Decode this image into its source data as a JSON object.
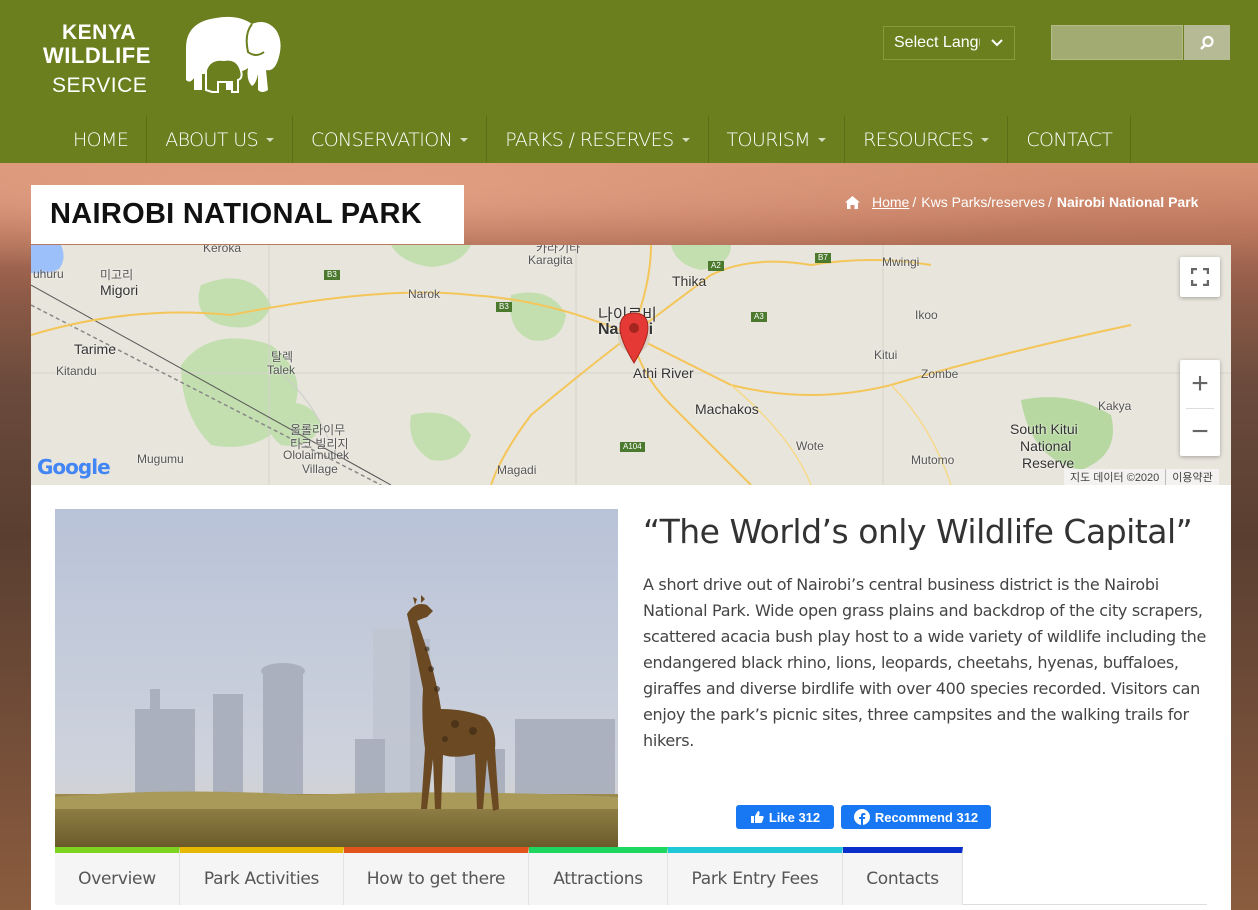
{
  "header": {
    "logo": {
      "line1": "KENYA",
      "line2": "WILDLIFE",
      "line3": "SERVICE"
    },
    "language_select": {
      "value": "Select Language"
    },
    "search": {
      "placeholder": ""
    }
  },
  "nav": {
    "items": [
      {
        "label": "HOME",
        "has_dropdown": false
      },
      {
        "label": "ABOUT US",
        "has_dropdown": true
      },
      {
        "label": "CONSERVATION",
        "has_dropdown": true
      },
      {
        "label": "PARKS / RESERVES",
        "has_dropdown": true
      },
      {
        "label": "TOURISM",
        "has_dropdown": true
      },
      {
        "label": "RESOURCES",
        "has_dropdown": true
      },
      {
        "label": "CONTACT",
        "has_dropdown": false
      }
    ]
  },
  "page": {
    "title": "NAIROBI NATIONAL PARK"
  },
  "breadcrumb": {
    "home": "Home",
    "separator": "/",
    "parent": "Kws Parks/reserves",
    "current": "Nairobi National Park"
  },
  "map": {
    "labels": {
      "keroka": "Keroka",
      "karagita_ko": "카라기타",
      "karagita": "Karagita",
      "thika": "Thika",
      "mwingi": "Mwingi",
      "migori_ko": "미고리",
      "migori": "Migori",
      "uhuru": "uhuru",
      "narok": "Narok",
      "nairobi_ko": "나이로비",
      "nairobi": "Nairobi",
      "ikoo": "Ikoo",
      "tarime": "Tarime",
      "kitandu": "Kitandu",
      "talek_ko": "탈렉",
      "talek": "Talek",
      "athi_river": "Athi River",
      "kitui": "Kitui",
      "zombe": "Zombe",
      "machakos": "Machakos",
      "kakya": "Kakya",
      "ololaimutiek_ko1": "올롤라이무",
      "ololaimutiek_ko2": "티크 빌리지",
      "ololaimutiek1": "Ololaimutiek",
      "ololaimutiek2": "Village",
      "south_kitui1": "South Kitui",
      "south_kitui2": "National",
      "south_kitui3": "Reserve",
      "mugumu": "Mugumu",
      "wote": "Wote",
      "mutomo": "Mutomo",
      "magadi": "Magadi"
    },
    "road_shields": [
      "B3",
      "B3",
      "A2",
      "B7",
      "A3",
      "A104"
    ],
    "attribution": "지도 데이터 ©2020",
    "terms": "이용약관",
    "google": "Google",
    "zoom_in": "+",
    "zoom_out": "−"
  },
  "content": {
    "tagline": "“The World’s only Wildlife Capital”",
    "description": "A short drive out of Nairobi’s central business district is the Nairobi National Park. Wide open grass plains and backdrop of the city scrapers, scattered acacia bush play host to a wide variety of wildlife including the endangered black rhino, lions, leopards, cheetahs, hyenas, buffaloes, giraffes and diverse birdlife with over 400 species recorded. Visitors can enjoy the park’s picnic sites, three campsites and the walking trails for hikers.",
    "fb_like": "Like 312",
    "fb_recommend": "Recommend 312"
  },
  "tabs": [
    {
      "label": "Overview",
      "color": "#7ed321"
    },
    {
      "label": "Park Activities",
      "color": "#e6b800"
    },
    {
      "label": "How to get there",
      "color": "#e0541b"
    },
    {
      "label": "Attractions",
      "color": "#1ed760"
    },
    {
      "label": "Park Entry Fees",
      "color": "#1fc8d8"
    },
    {
      "label": "Contacts",
      "color": "#0a2ec9"
    }
  ],
  "colors": {
    "header_green": "#6b7f1f",
    "facebook_blue": "#1877f2",
    "map_pin": "#e53935"
  },
  "icons": {
    "search": "search-icon",
    "home": "home-icon",
    "fullscreen": "fullscreen-icon",
    "map_pin": "map-pin-icon",
    "thumbs_up": "thumbs-up-icon",
    "facebook": "facebook-icon",
    "chevron": "chevron-down-icon",
    "logo_elephant": "elephant-logo-icon"
  }
}
